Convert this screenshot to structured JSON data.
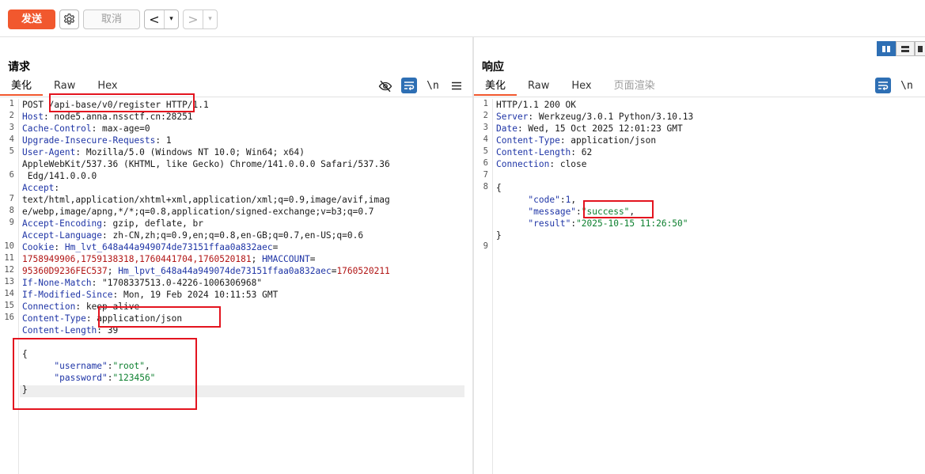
{
  "toolbar": {
    "send_label": "发送",
    "cancel_label": "取消",
    "back_arrow": "<",
    "fwd_arrow": ">",
    "dropdown_arrow": "▾",
    "send_color": "#f1582e"
  },
  "request": {
    "title": "请求",
    "tabs": [
      "美化",
      "Raw",
      "Hex"
    ],
    "newline_label": "\\n",
    "menu_label": "≡",
    "line_numbers": [
      "1",
      "2",
      "3",
      "4",
      "5",
      "",
      "6",
      "",
      "7",
      "8",
      "9",
      "",
      "10",
      "11",
      "12",
      "13",
      "14",
      "15",
      "16"
    ],
    "lines": [
      {
        "segs": [
          {
            "t": "POST /api-base/v0/register HTTP/1.1",
            "c": "plain"
          }
        ]
      },
      {
        "segs": [
          {
            "t": "Host",
            "c": "hk"
          },
          {
            "t": ": node5.anna.nssctf.cn:28251",
            "c": "hv"
          }
        ]
      },
      {
        "segs": [
          {
            "t": "Cache-Control",
            "c": "hk"
          },
          {
            "t": ": max-age=0",
            "c": "hv"
          }
        ]
      },
      {
        "segs": [
          {
            "t": "Upgrade-Insecure-Requests",
            "c": "hk"
          },
          {
            "t": ": 1",
            "c": "hv"
          }
        ]
      },
      {
        "segs": [
          {
            "t": "User-Agent",
            "c": "hk"
          },
          {
            "t": ": Mozilla/5.0 (Windows NT 10.0; Win64; x64)",
            "c": "hv"
          }
        ]
      },
      {
        "segs": [
          {
            "t": "AppleWebKit/537.36 (KHTML, like Gecko) Chrome/141.0.0.0 Safari/537.36",
            "c": "hv"
          }
        ]
      },
      {
        "segs": [
          {
            "t": " Edg/141.0.0.0",
            "c": "hv"
          }
        ]
      },
      {
        "segs": [
          {
            "t": "Accept",
            "c": "hk"
          },
          {
            "t": ":",
            "c": "hv"
          }
        ]
      },
      {
        "segs": [
          {
            "t": "text/html,application/xhtml+xml,application/xml;q=0.9,image/avif,imag",
            "c": "hv"
          }
        ]
      },
      {
        "segs": [
          {
            "t": "e/webp,image/apng,*/*;q=0.8,application/signed-exchange;v=b3;q=0.7",
            "c": "hv"
          }
        ]
      },
      {
        "segs": [
          {
            "t": "Accept-Encoding",
            "c": "hk"
          },
          {
            "t": ": gzip, deflate, br",
            "c": "hv"
          }
        ]
      },
      {
        "segs": [
          {
            "t": "Accept-Language",
            "c": "hk"
          },
          {
            "t": ": zh-CN,zh;q=0.9,en;q=0.8,en-GB;q=0.7,en-US;q=0.6",
            "c": "hv"
          }
        ]
      },
      {
        "segs": [
          {
            "t": "Cookie",
            "c": "hk"
          },
          {
            "t": ": ",
            "c": "hv"
          },
          {
            "t": "Hm_lvt_648a44a949074de73151ffaa0a832aec",
            "c": "hk"
          },
          {
            "t": "=",
            "c": "hv"
          }
        ]
      },
      {
        "segs": [
          {
            "t": "1758949906,1759138318,1760441704,1760520181",
            "c": "red"
          },
          {
            "t": "; ",
            "c": "hv"
          },
          {
            "t": "HMACCOUNT",
            "c": "hk"
          },
          {
            "t": "=",
            "c": "hv"
          }
        ]
      },
      {
        "segs": [
          {
            "t": "95360D9236FEC537",
            "c": "red"
          },
          {
            "t": "; ",
            "c": "hv"
          },
          {
            "t": "Hm_lpvt_648a44a949074de73151ffaa0a832aec",
            "c": "hk"
          },
          {
            "t": "=",
            "c": "hv"
          },
          {
            "t": "1760520211",
            "c": "red"
          }
        ]
      },
      {
        "segs": [
          {
            "t": "If-None-Match",
            "c": "hk"
          },
          {
            "t": ": \"1708337513.0-4226-1006306968\"",
            "c": "hv"
          }
        ]
      },
      {
        "segs": [
          {
            "t": "If-Modified-Since",
            "c": "hk"
          },
          {
            "t": ": Mon, 19 Feb 2024 10:11:53 GMT",
            "c": "hv"
          }
        ]
      },
      {
        "segs": [
          {
            "t": "Connection",
            "c": "hk"
          },
          {
            "t": ": keep-alive",
            "c": "hv"
          }
        ]
      },
      {
        "segs": [
          {
            "t": "Content-Type",
            "c": "hk"
          },
          {
            "t": ": application/json",
            "c": "hv"
          }
        ]
      },
      {
        "segs": [
          {
            "t": "Content-Length",
            "c": "hk"
          },
          {
            "t": ": 39",
            "c": "hv"
          }
        ]
      },
      {
        "segs": [
          {
            "t": "",
            "c": "hv"
          }
        ]
      },
      {
        "segs": [
          {
            "t": "{",
            "c": "plain"
          }
        ]
      },
      {
        "segs": [
          {
            "t": "      ",
            "c": "plain"
          },
          {
            "t": "\"username\"",
            "c": "jk"
          },
          {
            "t": ":",
            "c": "plain"
          },
          {
            "t": "\"root\"",
            "c": "jv"
          },
          {
            "t": ",",
            "c": "plain"
          }
        ]
      },
      {
        "segs": [
          {
            "t": "      ",
            "c": "plain"
          },
          {
            "t": "\"password\"",
            "c": "jk"
          },
          {
            "t": ":",
            "c": "plain"
          },
          {
            "t": "\"123456\"",
            "c": "jv"
          }
        ]
      },
      {
        "segs": [
          {
            "t": "}",
            "c": "plain"
          }
        ]
      }
    ]
  },
  "response": {
    "title": "响应",
    "tabs": [
      "美化",
      "Raw",
      "Hex",
      "页面渲染"
    ],
    "newline_label": "\\n",
    "line_numbers": [
      "1",
      "2",
      "3",
      "4",
      "5",
      "6",
      "7",
      "8",
      "",
      "",
      "",
      "",
      "9"
    ],
    "lines": [
      {
        "segs": [
          {
            "t": "HTTP/1.1 200 OK",
            "c": "plain"
          }
        ]
      },
      {
        "segs": [
          {
            "t": "Server",
            "c": "hk"
          },
          {
            "t": ": Werkzeug/3.0.1 Python/3.10.13",
            "c": "hv"
          }
        ]
      },
      {
        "segs": [
          {
            "t": "Date",
            "c": "hk"
          },
          {
            "t": ": Wed, 15 Oct 2025 12:01:23 GMT",
            "c": "hv"
          }
        ]
      },
      {
        "segs": [
          {
            "t": "Content-Type",
            "c": "hk"
          },
          {
            "t": ": application/json",
            "c": "hv"
          }
        ]
      },
      {
        "segs": [
          {
            "t": "Content-Length",
            "c": "hk"
          },
          {
            "t": ": 62",
            "c": "hv"
          }
        ]
      },
      {
        "segs": [
          {
            "t": "Connection",
            "c": "hk"
          },
          {
            "t": ": close",
            "c": "hv"
          }
        ]
      },
      {
        "segs": [
          {
            "t": "",
            "c": "hv"
          }
        ]
      },
      {
        "segs": [
          {
            "t": "{",
            "c": "plain"
          }
        ]
      },
      {
        "segs": [
          {
            "t": "      ",
            "c": "plain"
          },
          {
            "t": "\"code\"",
            "c": "jk"
          },
          {
            "t": ":",
            "c": "plain"
          },
          {
            "t": "1",
            "c": "jk"
          },
          {
            "t": ",",
            "c": "plain"
          }
        ]
      },
      {
        "segs": [
          {
            "t": "      ",
            "c": "plain"
          },
          {
            "t": "\"message\"",
            "c": "jk"
          },
          {
            "t": ":",
            "c": "plain"
          },
          {
            "t": "\"success\"",
            "c": "jv"
          },
          {
            "t": ",",
            "c": "plain"
          }
        ]
      },
      {
        "segs": [
          {
            "t": "      ",
            "c": "plain"
          },
          {
            "t": "\"result\"",
            "c": "jk"
          },
          {
            "t": ":",
            "c": "plain"
          },
          {
            "t": "\"2025-10-15 11:26:50\"",
            "c": "jv"
          }
        ]
      },
      {
        "segs": [
          {
            "t": "}",
            "c": "plain"
          }
        ]
      },
      {
        "segs": [
          {
            "t": "",
            "c": "plain"
          }
        ]
      }
    ]
  },
  "colors": {
    "accent": "#f1582e",
    "header_key": "#1f35a6",
    "json_string": "#0c7f2e",
    "cookie_value": "#b11414",
    "highlight_box": "#e3141f",
    "toggle_active": "#2e6fb4"
  },
  "icons": {
    "settings": "gear-icon",
    "hide": "eye-slash-icon",
    "wrap": "word-wrap-icon",
    "menu": "hamburger-menu-icon",
    "layout_columns": "columns-layout-icon",
    "layout_rows": "rows-layout-icon",
    "layout_single": "single-layout-icon"
  }
}
